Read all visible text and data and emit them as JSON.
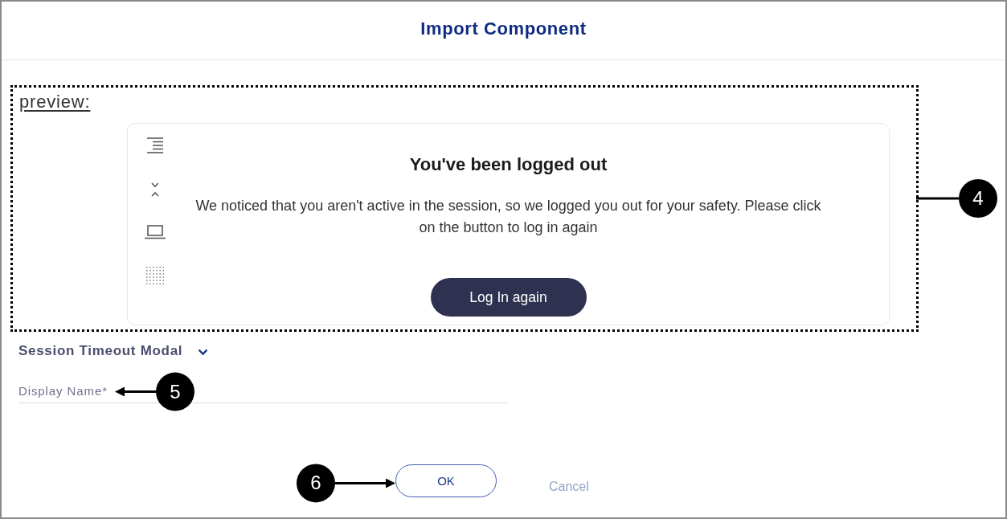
{
  "dialog": {
    "title": "Import Component"
  },
  "preview": {
    "label": "preview:",
    "callout": "4",
    "card": {
      "title": "You've been logged out",
      "message": "We noticed that you aren't active in the session, so we logged you out for your safety. Please click on the button to log in again",
      "button": "Log In again"
    }
  },
  "component": {
    "name": "Session Timeout Modal"
  },
  "display_name": {
    "label": "Display Name*",
    "callout": "5"
  },
  "buttons": [
    {
      "label": "OK",
      "kind": "primary",
      "callout": "6"
    },
    {
      "label": "Cancel",
      "kind": "link"
    }
  ]
}
